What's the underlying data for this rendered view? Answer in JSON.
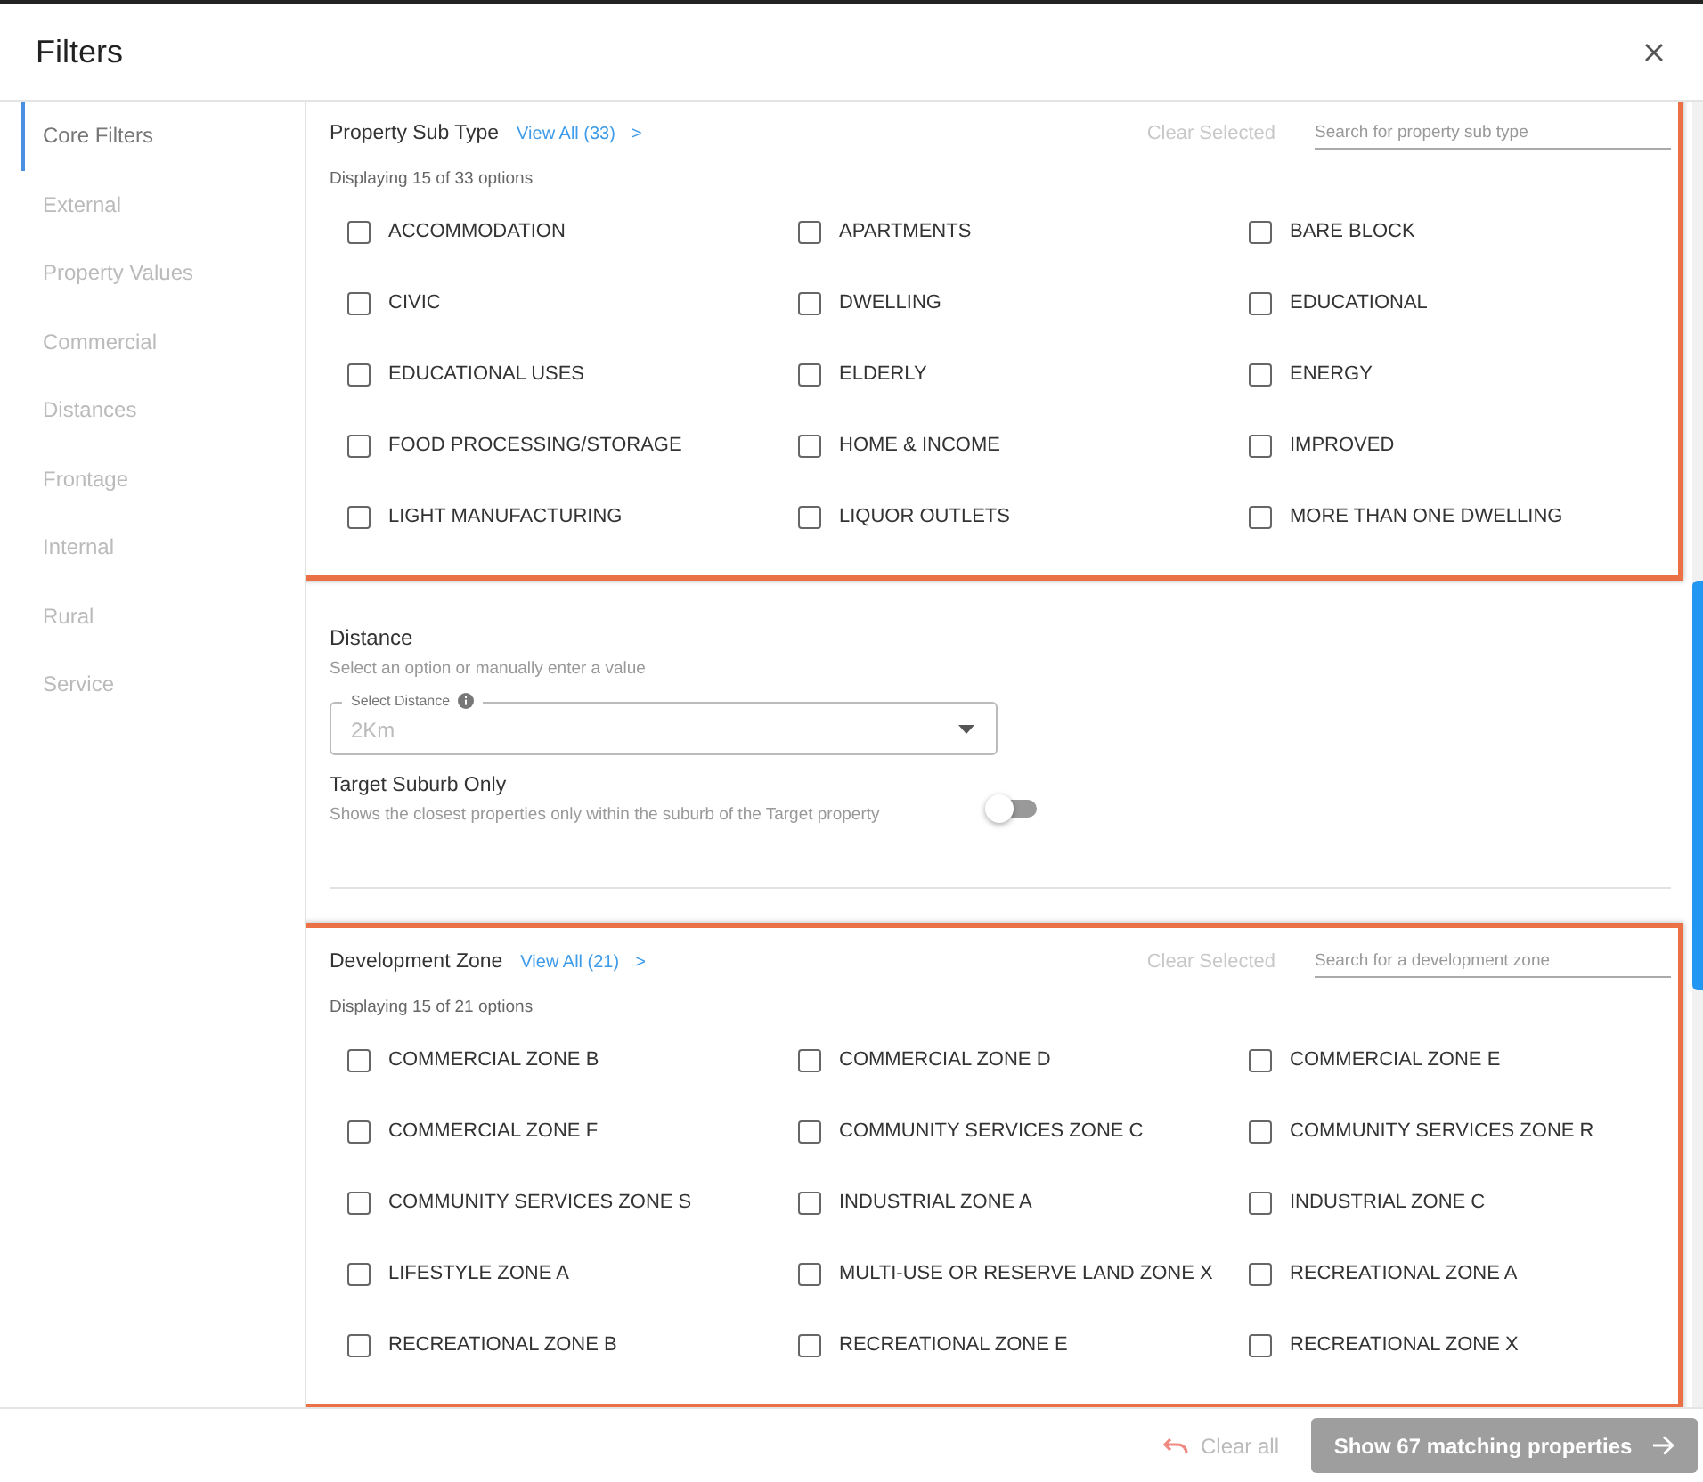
{
  "window": {
    "title": "Filters"
  },
  "sidebar": {
    "items": [
      {
        "label": "Core Filters",
        "selected": true
      },
      {
        "label": "External",
        "selected": false
      },
      {
        "label": "Property Values",
        "selected": false
      },
      {
        "label": "Commercial",
        "selected": false
      },
      {
        "label": "Distances",
        "selected": false
      },
      {
        "label": "Frontage",
        "selected": false
      },
      {
        "label": "Internal",
        "selected": false
      },
      {
        "label": "Rural",
        "selected": false
      },
      {
        "label": "Service",
        "selected": false
      }
    ]
  },
  "property_sub_type": {
    "title": "Property Sub Type",
    "view_all": "View All (33)",
    "chevron": ">",
    "clear": "Clear Selected",
    "placeholder": "Search for property sub type",
    "summary": "Displaying 15 of 33 options",
    "highlighted": true,
    "options": [
      {
        "label": "ACCOMMODATION",
        "checked": false
      },
      {
        "label": "APARTMENTS",
        "checked": false
      },
      {
        "label": "BARE BLOCK",
        "checked": false
      },
      {
        "label": "CIVIC",
        "checked": false
      },
      {
        "label": "DWELLING",
        "checked": false
      },
      {
        "label": "EDUCATIONAL",
        "checked": false
      },
      {
        "label": "EDUCATIONAL USES",
        "checked": false
      },
      {
        "label": "ELDERLY",
        "checked": false
      },
      {
        "label": "ENERGY",
        "checked": false
      },
      {
        "label": "FOOD PROCESSING/STORAGE",
        "checked": false
      },
      {
        "label": "HOME & INCOME",
        "checked": false
      },
      {
        "label": "IMPROVED",
        "checked": false
      },
      {
        "label": "LIGHT MANUFACTURING",
        "checked": false
      },
      {
        "label": "LIQUOR OUTLETS",
        "checked": false
      },
      {
        "label": "MORE THAN ONE DWELLING",
        "checked": false
      }
    ]
  },
  "distance": {
    "title": "Distance",
    "hint": "Select an option or manually enter a value",
    "select_label": "Select Distance",
    "value": "2Km",
    "target_suburb": {
      "title": "Target Suburb Only",
      "description": "Shows the closest properties only within the suburb of the Target property",
      "on": false
    }
  },
  "development_zone": {
    "title": "Development Zone",
    "view_all": "View All (21)",
    "chevron": ">",
    "clear": "Clear Selected",
    "placeholder": "Search for a development zone",
    "summary": "Displaying 15 of 21 options",
    "highlighted": true,
    "options": [
      {
        "label": "COMMERCIAL ZONE B",
        "checked": false
      },
      {
        "label": "COMMERCIAL ZONE D",
        "checked": false
      },
      {
        "label": "COMMERCIAL ZONE E",
        "checked": false
      },
      {
        "label": "COMMERCIAL ZONE F",
        "checked": false
      },
      {
        "label": "COMMUNITY SERVICES ZONE C",
        "checked": false
      },
      {
        "label": "COMMUNITY SERVICES ZONE R",
        "checked": false
      },
      {
        "label": "COMMUNITY SERVICES ZONE S",
        "checked": false
      },
      {
        "label": "INDUSTRIAL ZONE A",
        "checked": false
      },
      {
        "label": "INDUSTRIAL ZONE C",
        "checked": false
      },
      {
        "label": "LIFESTYLE ZONE A",
        "checked": false
      },
      {
        "label": "MULTI-USE OR RESERVE LAND ZONE X",
        "checked": false
      },
      {
        "label": "RECREATIONAL ZONE A",
        "checked": false
      },
      {
        "label": "RECREATIONAL ZONE B",
        "checked": false
      },
      {
        "label": "RECREATIONAL ZONE E",
        "checked": false
      },
      {
        "label": "RECREATIONAL ZONE X",
        "checked": false
      }
    ]
  },
  "footer": {
    "clear_all": "Clear all",
    "show_button": "Show 67 matching properties",
    "show_disabled": true
  }
}
